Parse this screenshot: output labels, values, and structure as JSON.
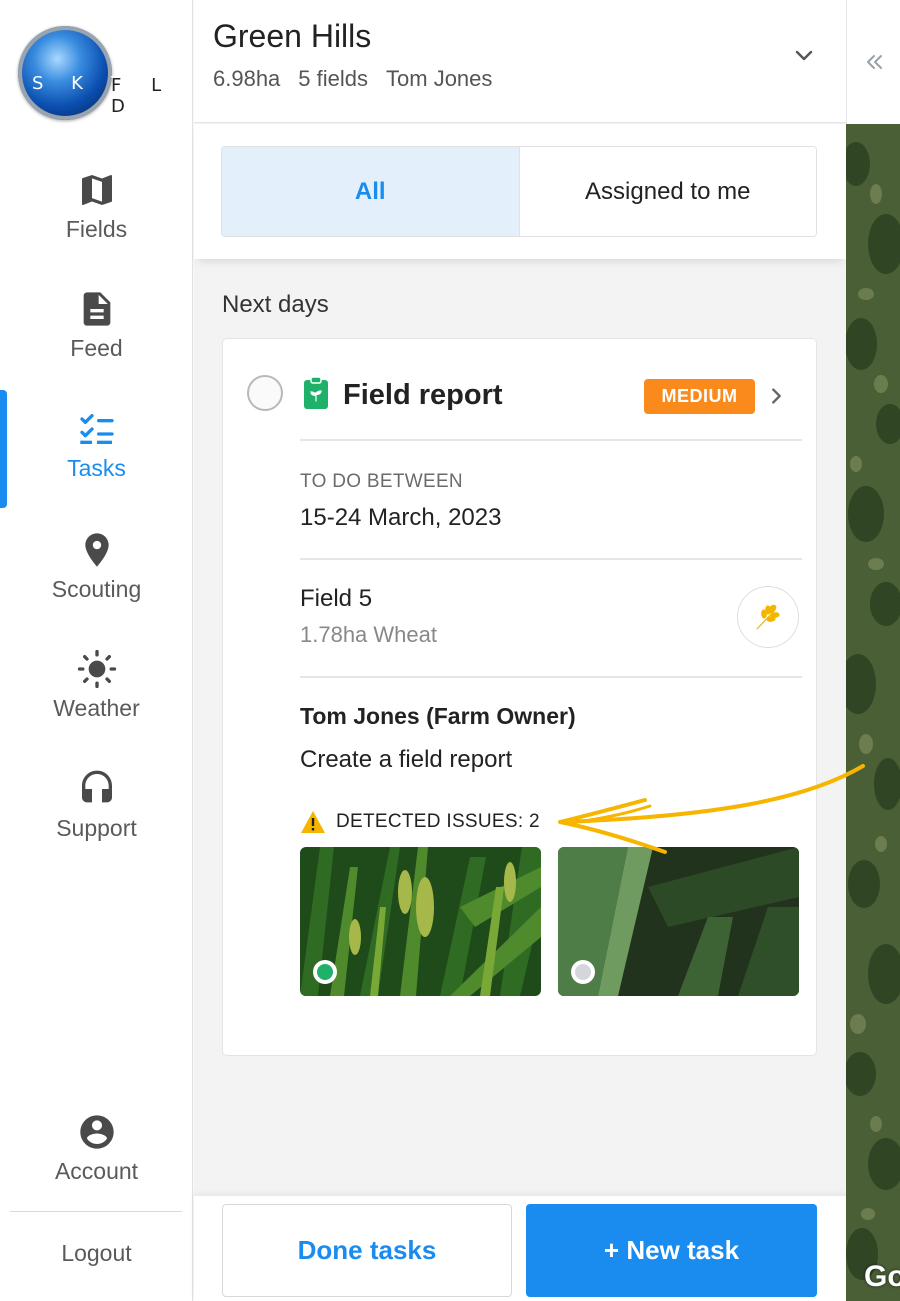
{
  "brand": {
    "logo_text": "SKYFLD",
    "logo_sky": "S K Y",
    "logo_fld": "F L D"
  },
  "sidebar": {
    "items": [
      {
        "label": "Fields",
        "icon": "map-icon",
        "active": false
      },
      {
        "label": "Feed",
        "icon": "document-icon",
        "active": false
      },
      {
        "label": "Tasks",
        "icon": "checklist-icon",
        "active": true
      },
      {
        "label": "Scouting",
        "icon": "location-pin-icon",
        "active": false
      },
      {
        "label": "Weather",
        "icon": "sun-icon",
        "active": false
      },
      {
        "label": "Support",
        "icon": "headset-icon",
        "active": false
      }
    ],
    "account_label": "Account",
    "logout_label": "Logout"
  },
  "header": {
    "farm_name": "Green Hills",
    "area": "6.98ha",
    "field_count": "5 fields",
    "owner": "Tom Jones"
  },
  "filter": {
    "all_label": "All",
    "assigned_label": "Assigned to me",
    "selected": "All"
  },
  "section": {
    "heading": "Next days"
  },
  "task": {
    "title": "Field report",
    "priority": "MEDIUM",
    "todo_label": "TO DO BETWEEN",
    "date_range": "15-24 March, 2023",
    "field_name": "Field 5",
    "field_details": "1.78ha Wheat",
    "assignee": "Tom Jones (Farm Owner)",
    "description": "Create a field report",
    "issues_label": "DETECTED ISSUES: 2",
    "photos": [
      {
        "subject": "wheat-ears",
        "status": "done"
      },
      {
        "subject": "wheat-leaf",
        "status": "pending"
      }
    ]
  },
  "actions": {
    "done_label": "Done tasks",
    "new_label": "+ New task"
  },
  "map": {
    "attribution": "Go"
  },
  "colors": {
    "accent": "#1a8cf0",
    "priority_medium": "#f98a1b",
    "report_icon": "#1fb16a",
    "warning": "#f5b400",
    "annotation_arrow": "#f7b500"
  }
}
